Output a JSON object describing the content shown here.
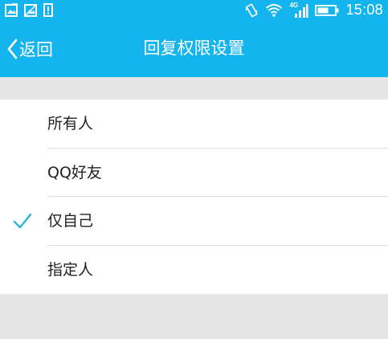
{
  "status_bar": {
    "time": "15:08",
    "network": "4G",
    "icons": [
      "notification-image-icon",
      "gallery-icon",
      "alert-icon",
      "vibrate-icon",
      "wifi-icon",
      "signal-icon",
      "battery-icon"
    ]
  },
  "header": {
    "back_label": "返回",
    "title": "回复权限设置",
    "background_color": "#14b4ef"
  },
  "options": [
    {
      "label": "所有人",
      "selected": false
    },
    {
      "label": "QQ好友",
      "selected": false
    },
    {
      "label": "仅自己",
      "selected": true
    },
    {
      "label": "指定人",
      "selected": false
    }
  ],
  "colors": {
    "accent": "#14b4ef",
    "check": "#2bb4d6",
    "page_background": "#e6e6e6"
  }
}
